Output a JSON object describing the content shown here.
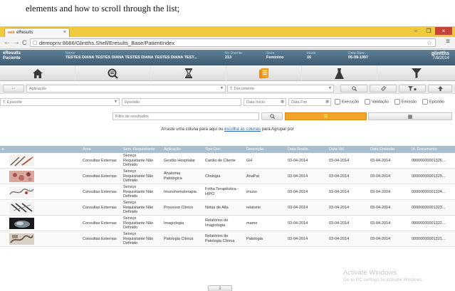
{
  "document": {
    "caption_text": "elements and how to scroll through the list;"
  },
  "browser": {
    "tab_title": "eResults",
    "tab_favicon_text": "web",
    "url": "demopriv:8666/Glintths.Shell/Eresults_Base/PatientIndex",
    "back_icon": "←",
    "forward_icon": "→",
    "reload_icon": "C",
    "star_icon": "☆",
    "menu_icon": "≡",
    "tab_close": "×",
    "win_min": "–",
    "win_max": "❐",
    "win_close": "×"
  },
  "header": {
    "app_name": "eResults",
    "app_sub": "Paciente",
    "fields": [
      {
        "label": "Nome",
        "value": "TESTES DIANA TESTES DIANA TESTES DIANA TESTES DIANA TEST..."
      },
      {
        "label": "Nr. Doente",
        "value": "213"
      },
      {
        "label": "Sexo",
        "value": "Feminino"
      },
      {
        "label": "Idade",
        "value": "16"
      },
      {
        "label": "Data Nasc.",
        "value": "05-09-1997"
      }
    ],
    "user": "glintths",
    "date": "7/8/2014"
  },
  "icon_bar": [
    "home-icon",
    "search-doc-icon",
    "hourglass-icon",
    "documents-icon",
    "flask-icon",
    "funnel-icon"
  ],
  "filters": {
    "back_label": "←",
    "aplicacao_placeholder": "Aplicação",
    "tipo_documento_placeholder": "T. Documento",
    "search_btn": "🔍",
    "clear_btn": "⌫",
    "filter_btn": "▼▪",
    "up_btn": "⬆",
    "tipo_episodio_placeholder": "T. Episódio",
    "episodio_placeholder": "Episódio",
    "data_inicio_placeholder": "Data Início",
    "data_fim_placeholder": "Data Fim",
    "checks": [
      "Execução",
      "Validação",
      "Emissão",
      "Episódio"
    ],
    "filtro_resultados_placeholder": "Filtro de resultados",
    "list_view_icon": "☰",
    "grid_view_icon": "▦"
  },
  "drag_hint": {
    "pre": "Arraste uma coluna para aqui ou ",
    "link": "escolha as colunas",
    "post": " para Agrupar por"
  },
  "table": {
    "columns": [
      "Área",
      "Serv. Requisitante",
      "Aplicação",
      "Tipo Doc.",
      "Descrição",
      "Data Realiz.",
      "Data Val.",
      "Data Emissão",
      "Id. Documento"
    ],
    "rows": [
      {
        "area": "Consultas Externas",
        "serv": [
          "Serviço",
          "Requisitante Não",
          "Definido"
        ],
        "aplicacao": [
          "Gestão Hospitalar"
        ],
        "tipo": [
          "Cartão de Cliente"
        ],
        "descricao": "GH",
        "realiz": "03-04-2014",
        "val": "03-04-2014",
        "emissao": "03-04-2014",
        "id": "00000000001326..."
      },
      {
        "area": "Consultas Externas",
        "serv": [
          "Serviço",
          "Requisitante Não",
          "Definido"
        ],
        "aplicacao": [
          "Anatomia",
          "Patológica"
        ],
        "tipo": [
          "Citologia"
        ],
        "descricao": "AnaPat",
        "realiz": "03-04-2014",
        "val": "03-04-2014",
        "emissao": "03-04-2014",
        "id": "00000000001325..."
      },
      {
        "area": "Consultas Externas",
        "serv": [
          "Serviço",
          "Requisitante Não",
          "Definido"
        ],
        "aplicacao": [
          "Imunohemoterapia"
        ],
        "tipo": [
          "Folha Terapêutica -",
          "HIPO"
        ],
        "descricao": "imuno",
        "realiz": "03-04-2014",
        "val": "03-04-2014",
        "emissao": "03-04-2014",
        "id": "00000000001324..."
      },
      {
        "area": "Consultas Externas",
        "serv": [
          "Serviço",
          "Requisitante Não",
          "Definido"
        ],
        "aplicacao": [
          "Processo Clínico"
        ],
        "tipo": [
          "Notas de Alta"
        ],
        "descricao": "relatorio",
        "realiz": "03-04-2014",
        "val": "03-04-2014",
        "emissao": "03-04-2014",
        "id": "00000000001323..."
      },
      {
        "area": "Consultas Externas",
        "serv": [
          "Serviço",
          "Requisitante Não",
          "Definido"
        ],
        "aplicacao": [
          "Imagiologia"
        ],
        "tipo": [
          "Relatórios de",
          "Imagiologia"
        ],
        "descricao": "mamo",
        "realiz": "03-04-2014",
        "val": "03-04-2014",
        "emissao": "03-04-2014",
        "id": "00000000001322..."
      },
      {
        "area": "Consultas Externas",
        "serv": [
          "Serviço",
          "Requisitante Não",
          "Definido"
        ],
        "aplicacao": [
          "Patologia Clínica"
        ],
        "tipo": [
          "Relatórios de",
          "Patologia Clínica"
        ],
        "descricao": "Patologia",
        "realiz": "03-04-2014",
        "val": "03-04-2014",
        "emissao": "03-04-2014",
        "id": "00000000001321..."
      }
    ]
  },
  "watermark": {
    "line1": "Activate Windows",
    "line2": "Go to PC settings to activate Windows."
  },
  "bottom_button": "⇩",
  "colors": {
    "tabbar": "#f0ca3d",
    "header": "#4c6b82",
    "grid_head": "#a9bfd0",
    "active_toggle": "#f3a329"
  }
}
